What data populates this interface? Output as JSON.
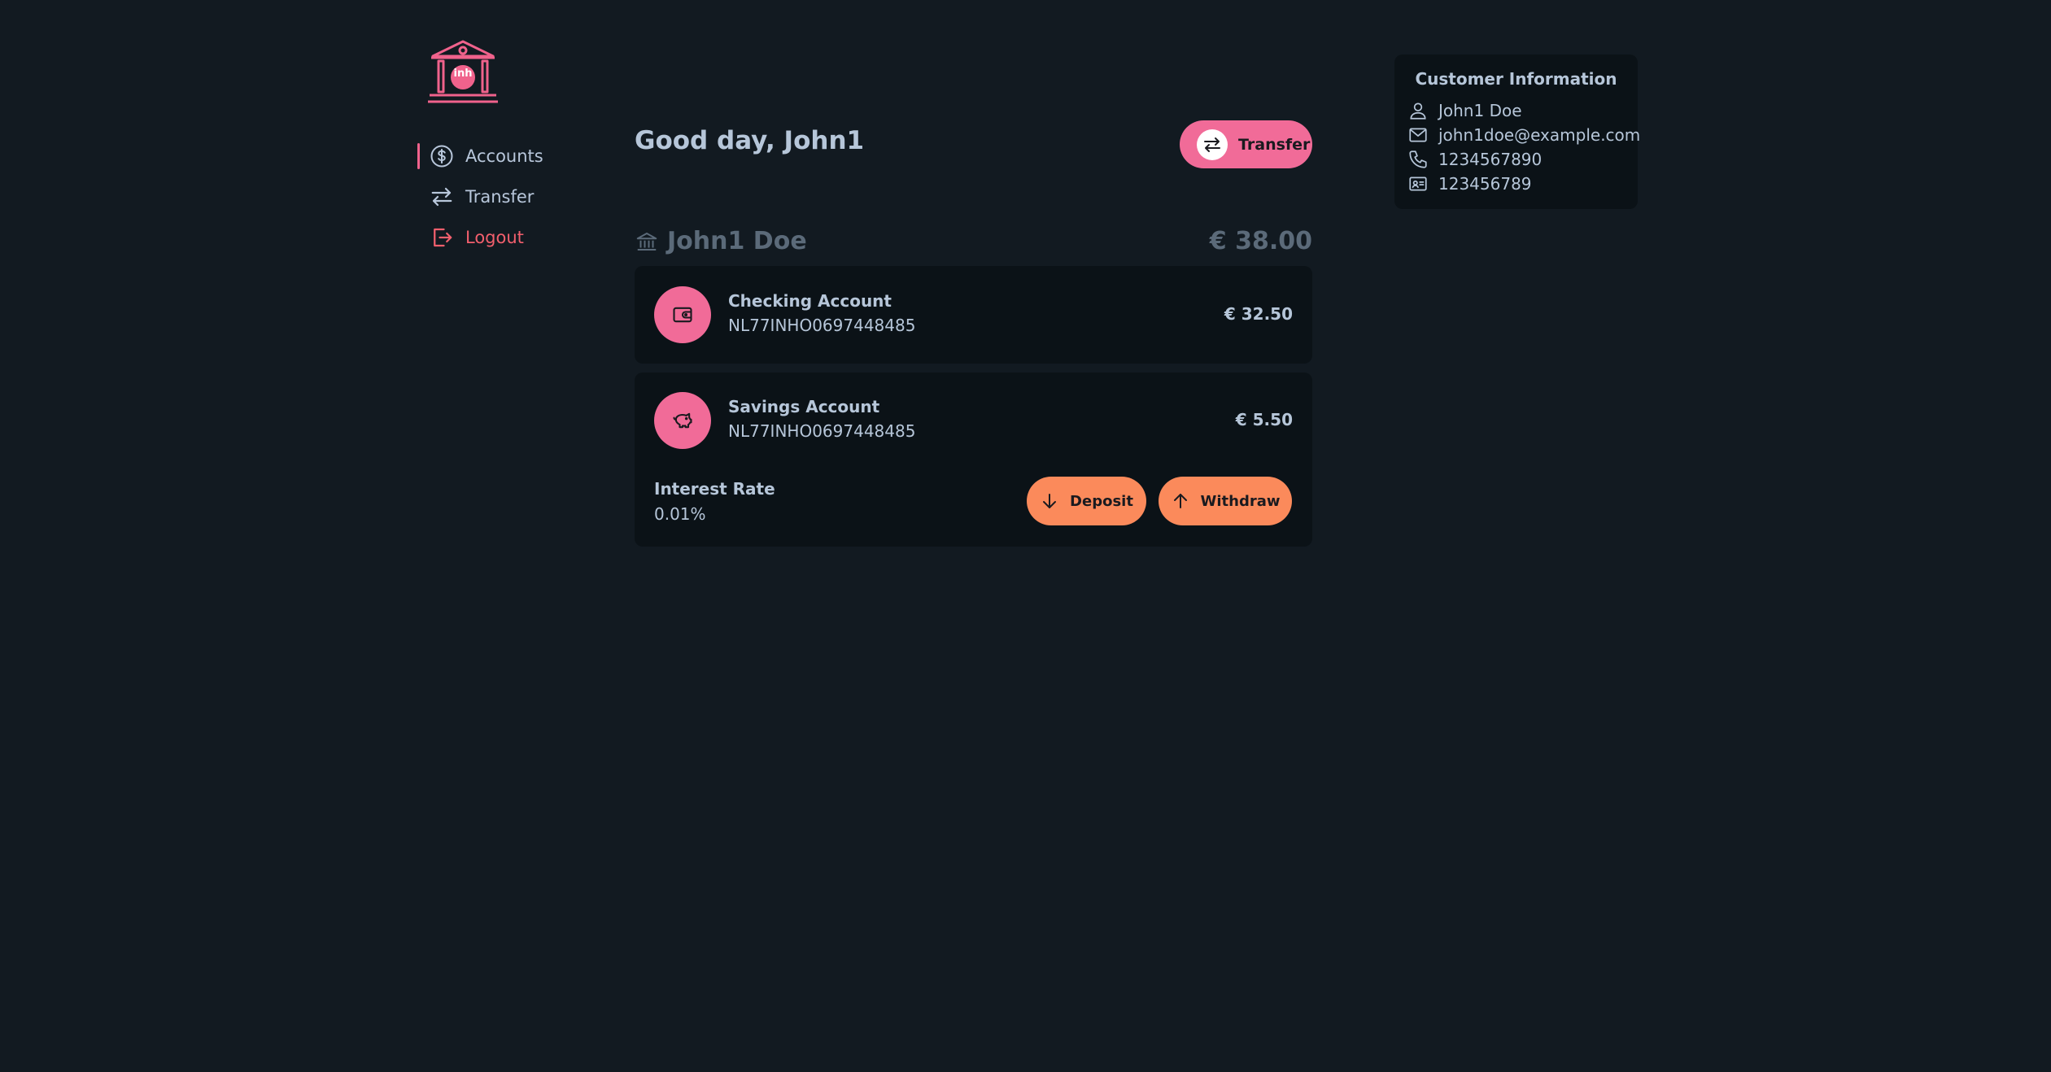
{
  "logo": {
    "text": "inh"
  },
  "sidebar": {
    "items": [
      {
        "label": "Accounts",
        "icon": "dollar-circle-icon"
      },
      {
        "label": "Transfer",
        "icon": "arrows-exchange-icon"
      },
      {
        "label": "Logout",
        "icon": "logout-icon"
      }
    ]
  },
  "header": {
    "greeting": "Good day, John1",
    "transfer_label": "Transfer"
  },
  "owner": {
    "name": "John1 Doe",
    "total": "€ 38.00"
  },
  "accounts": [
    {
      "name": "Checking Account",
      "iban": "NL77INHO0697448485",
      "balance": "€ 32.50",
      "icon": "wallet-icon"
    },
    {
      "name": "Savings Account",
      "iban": "NL77INHO0697448485",
      "balance": "€ 5.50",
      "icon": "piggy-bank-icon",
      "interest_label": "Interest Rate",
      "interest_value": "0.01%",
      "deposit_label": "Deposit",
      "withdraw_label": "Withdraw"
    }
  ],
  "customer": {
    "title": "Customer Information",
    "name": "John1 Doe",
    "email": "john1doe@example.com",
    "phone": "1234567890",
    "id": "123456789"
  },
  "colors": {
    "background": "#121a21",
    "card": "#0b1217",
    "pink": "#f16b98",
    "orange": "#fb8a5b",
    "logout": "#f25f6d"
  }
}
